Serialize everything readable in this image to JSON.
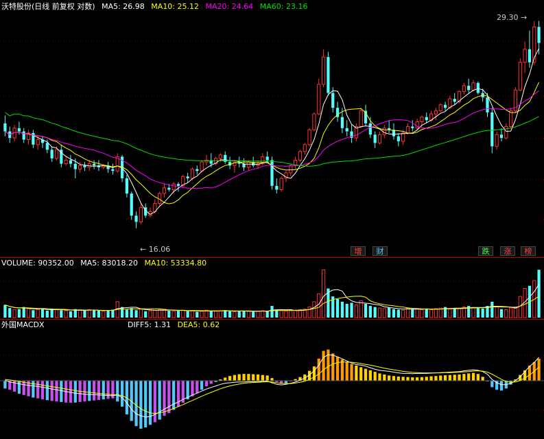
{
  "colors": {
    "up": "#ff3232",
    "down": "#54fcfc",
    "ma5": "#ffffff",
    "ma10": "#ffff00",
    "ma20": "#ff00ff",
    "ma60": "#00e000",
    "grid": "#7a0000",
    "separator": "#c00000",
    "macd_hot": "#ff9900",
    "macd_warm": "#ffd200",
    "macd_cold": "#54c8fc",
    "macd_neg": "#c850f0"
  },
  "price_header": {
    "title": "沃特股份(日线 前复权 对数)",
    "ma5": "MA5: 26.98",
    "ma10": "MA10: 25.12",
    "ma20": "MA20: 24.64",
    "ma60": "MA60: 23.16"
  },
  "volume_header": {
    "volume": "VOLUME: 90352.00",
    "ma5": "MA5: 83018.20",
    "ma10": "MA10: 53334.80"
  },
  "macd_header": {
    "title": "外国MACDX",
    "diff": "DIFF5: 1.31",
    "dea": "DEA5: 0.62"
  },
  "annotations": {
    "high": "29.30",
    "low": "16.06"
  },
  "events": [
    {
      "label": "增",
      "color": "#ff4040"
    },
    {
      "label": "财",
      "color": "#54c8fc"
    },
    {
      "label": "跌",
      "color": "#40ff40"
    },
    {
      "label": "涨",
      "color": "#ff4040"
    },
    {
      "label": "榜",
      "color": "#ff4040"
    }
  ],
  "chart_data": {
    "type": "candlestick",
    "y_scale": "log",
    "ylim": [
      15.5,
      29.8
    ],
    "candles": [
      [
        21.8,
        22.3,
        21.0,
        21.3
      ],
      [
        21.3,
        21.6,
        20.6,
        20.9
      ],
      [
        20.9,
        21.7,
        20.7,
        21.5
      ],
      [
        21.5,
        21.9,
        21.1,
        21.3
      ],
      [
        21.3,
        21.5,
        20.6,
        20.8
      ],
      [
        20.8,
        21.4,
        20.5,
        21.2
      ],
      [
        21.2,
        21.4,
        20.3,
        20.5
      ],
      [
        20.5,
        21.0,
        20.2,
        20.8
      ],
      [
        20.8,
        21.0,
        20.3,
        20.6
      ],
      [
        20.6,
        20.8,
        20.0,
        20.2
      ],
      [
        20.2,
        20.4,
        19.5,
        19.7
      ],
      [
        19.7,
        20.4,
        19.6,
        20.2
      ],
      [
        20.2,
        20.5,
        19.2,
        19.4
      ],
      [
        19.4,
        19.8,
        19.3,
        19.6
      ],
      [
        19.6,
        19.9,
        19.2,
        19.4
      ],
      [
        19.4,
        19.7,
        18.6,
        19.1
      ],
      [
        19.1,
        19.5,
        18.9,
        19.3
      ],
      [
        19.3,
        19.5,
        19.0,
        19.2
      ],
      [
        19.2,
        19.6,
        19.0,
        19.4
      ],
      [
        19.4,
        19.6,
        19.1,
        19.3
      ],
      [
        19.3,
        19.6,
        19.0,
        19.2
      ],
      [
        19.2,
        19.4,
        19.1,
        19.3
      ],
      [
        19.3,
        19.5,
        18.9,
        19.1
      ],
      [
        19.1,
        19.4,
        18.8,
        19.0
      ],
      [
        19.0,
        20.0,
        18.9,
        19.8
      ],
      [
        19.8,
        19.9,
        18.4,
        18.6
      ],
      [
        18.6,
        18.8,
        17.6,
        17.8
      ],
      [
        17.8,
        17.9,
        16.5,
        16.7
      ],
      [
        16.7,
        16.9,
        16.1,
        16.4
      ],
      [
        16.4,
        17.3,
        16.3,
        17.1
      ],
      [
        17.1,
        17.3,
        16.6,
        16.7
      ],
      [
        16.7,
        17.1,
        16.6,
        16.9
      ],
      [
        16.9,
        17.5,
        16.8,
        17.3
      ],
      [
        17.3,
        17.9,
        17.2,
        17.8
      ],
      [
        17.8,
        18.3,
        17.6,
        18.1
      ],
      [
        18.1,
        18.3,
        17.9,
        18.0
      ],
      [
        18.0,
        18.4,
        17.8,
        18.3
      ],
      [
        18.3,
        18.4,
        17.9,
        18.2
      ],
      [
        18.2,
        18.8,
        18.1,
        18.7
      ],
      [
        18.7,
        18.9,
        18.4,
        18.6
      ],
      [
        18.6,
        19.2,
        18.5,
        19.1
      ],
      [
        19.1,
        19.3,
        18.8,
        19.0
      ],
      [
        19.0,
        19.6,
        18.9,
        19.5
      ],
      [
        19.5,
        19.9,
        19.3,
        19.6
      ],
      [
        19.6,
        20.0,
        19.2,
        19.4
      ],
      [
        19.4,
        19.8,
        19.3,
        19.7
      ],
      [
        19.7,
        20.0,
        19.5,
        19.9
      ],
      [
        19.9,
        20.1,
        19.4,
        19.5
      ],
      [
        19.5,
        19.8,
        19.1,
        19.3
      ],
      [
        19.3,
        19.6,
        18.9,
        19.5
      ],
      [
        19.5,
        19.8,
        19.2,
        19.4
      ],
      [
        19.4,
        19.7,
        19.0,
        19.2
      ],
      [
        19.2,
        19.6,
        19.0,
        19.5
      ],
      [
        19.5,
        19.8,
        19.2,
        19.3
      ],
      [
        19.3,
        19.6,
        19.1,
        19.4
      ],
      [
        19.4,
        20.0,
        19.3,
        19.8
      ],
      [
        19.8,
        20.1,
        19.5,
        19.6
      ],
      [
        19.6,
        19.8,
        18.0,
        18.2
      ],
      [
        18.2,
        18.6,
        17.8,
        18.0
      ],
      [
        18.0,
        18.7,
        17.9,
        18.6
      ],
      [
        18.6,
        19.0,
        18.4,
        18.9
      ],
      [
        18.9,
        19.4,
        18.7,
        19.3
      ],
      [
        19.3,
        19.8,
        19.1,
        19.6
      ],
      [
        19.6,
        20.2,
        19.5,
        20.1
      ],
      [
        20.1,
        20.6,
        19.9,
        20.5
      ],
      [
        20.5,
        21.5,
        20.4,
        21.4
      ],
      [
        21.4,
        22.5,
        21.3,
        22.4
      ],
      [
        22.4,
        24.8,
        22.3,
        24.4
      ],
      [
        24.4,
        27.0,
        24.2,
        26.4
      ],
      [
        26.4,
        26.8,
        23.6,
        23.8
      ],
      [
        23.8,
        24.2,
        22.5,
        22.8
      ],
      [
        22.8,
        23.2,
        21.9,
        22.2
      ],
      [
        22.2,
        22.8,
        21.2,
        21.5
      ],
      [
        21.5,
        22.0,
        21.0,
        21.3
      ],
      [
        21.3,
        21.7,
        20.6,
        20.9
      ],
      [
        20.9,
        21.8,
        20.7,
        21.6
      ],
      [
        21.6,
        22.8,
        21.5,
        22.6
      ],
      [
        22.6,
        23.0,
        21.6,
        21.8
      ],
      [
        21.8,
        22.2,
        20.9,
        21.1
      ],
      [
        21.1,
        21.3,
        20.3,
        20.6
      ],
      [
        20.6,
        21.3,
        20.5,
        21.1
      ],
      [
        21.1,
        21.7,
        20.9,
        21.5
      ],
      [
        21.5,
        22.0,
        21.2,
        21.4
      ],
      [
        21.4,
        21.8,
        20.8,
        21.0
      ],
      [
        21.0,
        21.2,
        20.4,
        20.7
      ],
      [
        20.7,
        21.4,
        20.5,
        21.2
      ],
      [
        21.2,
        21.8,
        21.1,
        21.6
      ],
      [
        21.6,
        22.0,
        21.3,
        21.5
      ],
      [
        21.5,
        22.1,
        21.4,
        21.9
      ],
      [
        21.9,
        22.3,
        21.6,
        22.2
      ],
      [
        22.2,
        22.5,
        21.8,
        22.0
      ],
      [
        22.0,
        22.6,
        21.9,
        22.4
      ],
      [
        22.4,
        22.8,
        22.0,
        22.6
      ],
      [
        22.6,
        23.1,
        22.5,
        23.0
      ],
      [
        23.0,
        23.2,
        22.6,
        22.8
      ],
      [
        22.8,
        23.6,
        22.7,
        23.4
      ],
      [
        23.4,
        23.8,
        23.0,
        23.2
      ],
      [
        23.2,
        24.0,
        23.1,
        23.9
      ],
      [
        23.9,
        24.5,
        23.7,
        24.3
      ],
      [
        24.3,
        24.8,
        23.8,
        24.0
      ],
      [
        24.0,
        24.7,
        23.9,
        24.5
      ],
      [
        24.5,
        24.6,
        23.7,
        23.8
      ],
      [
        23.8,
        24.1,
        23.2,
        23.5
      ],
      [
        23.5,
        23.8,
        22.2,
        22.5
      ],
      [
        22.5,
        22.8,
        20.0,
        20.4
      ],
      [
        20.4,
        21.3,
        20.2,
        21.1
      ],
      [
        21.1,
        21.5,
        20.7,
        20.9
      ],
      [
        20.9,
        21.8,
        20.8,
        21.6
      ],
      [
        21.6,
        22.8,
        21.5,
        22.6
      ],
      [
        22.6,
        24.2,
        22.5,
        24.0
      ],
      [
        24.0,
        26.3,
        23.9,
        26.0
      ],
      [
        26.0,
        27.6,
        25.2,
        27.0
      ],
      [
        27.0,
        28.5,
        25.6,
        26.0
      ],
      [
        26.0,
        29.3,
        25.8,
        28.8
      ],
      [
        28.8,
        29.3,
        26.6,
        27.5
      ]
    ],
    "volume": [
      24000,
      18000,
      15000,
      16000,
      20000,
      17000,
      14000,
      15000,
      16000,
      13000,
      17000,
      15000,
      14000,
      13000,
      12000,
      16000,
      14000,
      13000,
      15000,
      14000,
      13000,
      12000,
      14000,
      15000,
      30000,
      20000,
      15000,
      18000,
      14000,
      16000,
      12000,
      13000,
      14000,
      15000,
      16000,
      13000,
      12000,
      13000,
      14000,
      12000,
      13000,
      11000,
      12000,
      14000,
      13000,
      12000,
      13000,
      14000,
      12000,
      11000,
      12000,
      13000,
      12000,
      11000,
      12000,
      13000,
      12000,
      22000,
      15000,
      13000,
      12000,
      13000,
      14000,
      15000,
      16000,
      20000,
      30000,
      45000,
      90000,
      55000,
      40000,
      35000,
      30000,
      26000,
      28000,
      24000,
      32000,
      26000,
      22000,
      20000,
      18000,
      17000,
      19000,
      16000,
      15000,
      14000,
      18000,
      16000,
      17000,
      15000,
      16000,
      15000,
      17000,
      18000,
      20000,
      16000,
      18000,
      17000,
      20000,
      22000,
      19000,
      18000,
      17000,
      22000,
      30000,
      20000,
      16000,
      15000,
      18000,
      20000,
      40000,
      55000,
      60000,
      70000,
      90352
    ],
    "macd": {
      "diff": [
        0.02,
        -0.05,
        -0.08,
        -0.12,
        -0.15,
        -0.18,
        -0.2,
        -0.22,
        -0.25,
        -0.28,
        -0.32,
        -0.35,
        -0.38,
        -0.42,
        -0.45,
        -0.48,
        -0.5,
        -0.52,
        -0.53,
        -0.54,
        -0.55,
        -0.56,
        -0.57,
        -0.58,
        -0.55,
        -0.65,
        -0.85,
        -1.1,
        -1.28,
        -1.35,
        -1.4,
        -1.38,
        -1.3,
        -1.2,
        -1.1,
        -1.0,
        -0.9,
        -0.82,
        -0.72,
        -0.64,
        -0.55,
        -0.48,
        -0.4,
        -0.32,
        -0.26,
        -0.2,
        -0.14,
        -0.1,
        -0.08,
        -0.06,
        -0.05,
        -0.05,
        -0.04,
        -0.04,
        -0.03,
        -0.02,
        -0.02,
        -0.08,
        -0.14,
        -0.16,
        -0.14,
        -0.1,
        -0.05,
        0.02,
        0.1,
        0.22,
        0.38,
        0.6,
        0.9,
        1.0,
        0.98,
        0.92,
        0.84,
        0.76,
        0.68,
        0.62,
        0.6,
        0.56,
        0.5,
        0.44,
        0.4,
        0.38,
        0.36,
        0.33,
        0.3,
        0.28,
        0.28,
        0.27,
        0.28,
        0.28,
        0.28,
        0.29,
        0.3,
        0.31,
        0.32,
        0.33,
        0.34,
        0.35,
        0.38,
        0.4,
        0.42,
        0.4,
        0.35,
        0.25,
        0.05,
        -0.08,
        -0.15,
        -0.15,
        -0.1,
        0.0,
        0.15,
        0.35,
        0.55,
        0.7,
        0.9
      ],
      "dea": [
        0.05,
        0.03,
        0.0,
        -0.03,
        -0.06,
        -0.09,
        -0.12,
        -0.14,
        -0.17,
        -0.2,
        -0.23,
        -0.26,
        -0.29,
        -0.32,
        -0.35,
        -0.38,
        -0.41,
        -0.43,
        -0.45,
        -0.47,
        -0.49,
        -0.51,
        -0.52,
        -0.54,
        -0.54,
        -0.58,
        -0.66,
        -0.8,
        -0.95,
        -1.08,
        -1.18,
        -1.24,
        -1.26,
        -1.24,
        -1.2,
        -1.14,
        -1.07,
        -1.0,
        -0.92,
        -0.84,
        -0.76,
        -0.68,
        -0.6,
        -0.52,
        -0.45,
        -0.38,
        -0.31,
        -0.25,
        -0.2,
        -0.16,
        -0.13,
        -0.1,
        -0.08,
        -0.07,
        -0.06,
        -0.05,
        -0.04,
        -0.05,
        -0.08,
        -0.1,
        -0.11,
        -0.11,
        -0.09,
        -0.06,
        -0.02,
        0.05,
        0.14,
        0.26,
        0.42,
        0.55,
        0.64,
        0.7,
        0.72,
        0.72,
        0.71,
        0.69,
        0.66,
        0.63,
        0.6,
        0.56,
        0.52,
        0.48,
        0.45,
        0.42,
        0.39,
        0.36,
        0.34,
        0.32,
        0.31,
        0.3,
        0.3,
        0.3,
        0.3,
        0.3,
        0.31,
        0.31,
        0.32,
        0.33,
        0.34,
        0.35,
        0.37,
        0.38,
        0.37,
        0.33,
        0.25,
        0.15,
        0.05,
        -0.03,
        -0.06,
        -0.05,
        0.01,
        0.1,
        0.22,
        0.36,
        0.52
      ],
      "bars": [
        -0.3,
        -0.35,
        -0.42,
        -0.5,
        -0.55,
        -0.6,
        -0.65,
        -0.68,
        -0.72,
        -0.75,
        -0.78,
        -0.8,
        -0.82,
        -0.84,
        -0.85,
        -0.84,
        -0.82,
        -0.8,
        -0.78,
        -0.76,
        -0.74,
        -0.72,
        -0.7,
        -0.68,
        -0.8,
        -1.0,
        -1.3,
        -1.55,
        -1.75,
        -1.85,
        -1.8,
        -1.7,
        -1.6,
        -1.5,
        -1.35,
        -1.25,
        -1.12,
        -1.0,
        -0.85,
        -0.72,
        -0.6,
        -0.48,
        -0.35,
        -0.22,
        -0.12,
        -0.05,
        0.05,
        0.12,
        0.18,
        0.22,
        0.25,
        0.26,
        0.26,
        0.25,
        0.24,
        0.22,
        0.2,
        0.1,
        -0.05,
        -0.12,
        -0.1,
        -0.02,
        0.06,
        0.14,
        0.24,
        0.38,
        0.55,
        0.85,
        1.15,
        1.2,
        1.05,
        0.92,
        0.82,
        0.72,
        0.64,
        0.58,
        0.52,
        0.46,
        0.4,
        0.34,
        0.28,
        0.24,
        0.2,
        0.18,
        0.16,
        0.15,
        0.14,
        0.13,
        0.13,
        0.14,
        0.15,
        0.17,
        0.18,
        0.2,
        0.21,
        0.22,
        0.23,
        0.24,
        0.26,
        0.28,
        0.3,
        0.26,
        0.15,
        -0.02,
        -0.25,
        -0.35,
        -0.38,
        -0.3,
        -0.15,
        0.05,
        0.22,
        0.4,
        0.58,
        0.72,
        0.85
      ]
    }
  }
}
